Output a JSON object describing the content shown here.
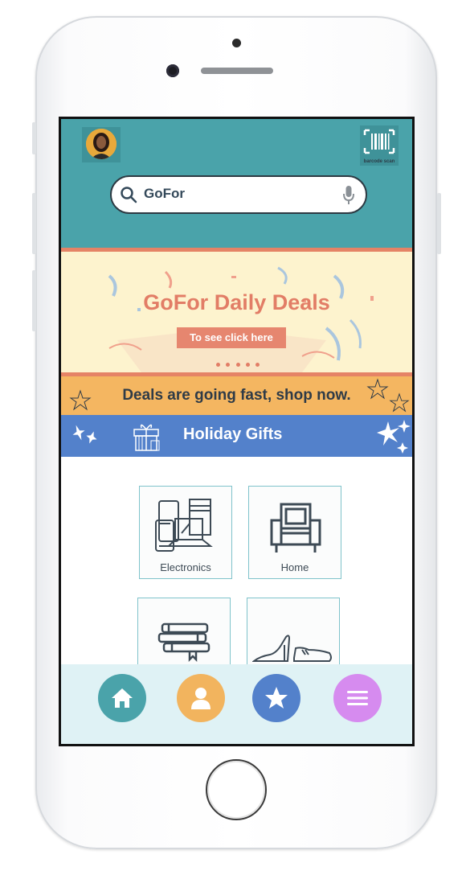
{
  "app": {
    "search": {
      "value": "GoFor"
    },
    "barcode_label": "barcode scan",
    "promo": {
      "title": "GoFor Daily Deals",
      "button_label": "To see click here"
    },
    "deals_banner": "Deals are going fast, shop now.",
    "holiday_banner": "Holiday Gifts",
    "categories": [
      {
        "label": "Electronics",
        "icon": "electronics-icon"
      },
      {
        "label": "Home",
        "icon": "armchair-icon"
      },
      {
        "label": "",
        "icon": "books-icon"
      },
      {
        "label": "",
        "icon": "shoes-icon"
      }
    ],
    "bottom_nav": [
      {
        "icon": "home-icon",
        "color": "#4aa3aa"
      },
      {
        "icon": "profile-icon",
        "color": "#f2b45e"
      },
      {
        "icon": "star-icon",
        "color": "#5381cb"
      },
      {
        "icon": "menu-icon",
        "color": "#d68bef"
      }
    ]
  },
  "colors": {
    "header": "#4aa3aa",
    "promo_bg": "#fdf3ce",
    "promo_accent": "#e27d66",
    "deals_bg": "#f4b661",
    "holiday_bg": "#5381cb",
    "nav_bg": "#dff2f5"
  }
}
